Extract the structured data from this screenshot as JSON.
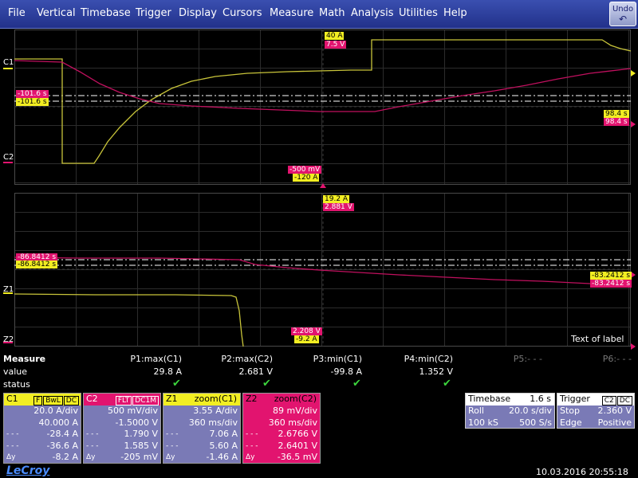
{
  "menu": [
    "File",
    "Vertical",
    "Timebase",
    "Trigger",
    "Display",
    "Cursors",
    "Measure",
    "Math",
    "Analysis",
    "Utilities",
    "Help"
  ],
  "undo_label": "Undo",
  "upper_plot": {
    "c1_label": "C1",
    "c2_label": "C2",
    "tag_top_a": "40 A",
    "tag_top_v": "7.5 V",
    "tag_left_1": "-101.6 s",
    "tag_left_2": "-101.6 s",
    "tag_right_1": "98.4 s",
    "tag_right_2": "98.4 s",
    "tag_bottom_v": "-500 mV",
    "tag_bottom_a": "-120 A"
  },
  "lower_plot": {
    "z1_label": "Z1",
    "z2_label": "Z2",
    "tag_top_a": "19.2 A",
    "tag_top_v": "2.881 V",
    "tag_left_1": "-86.8412 s",
    "tag_left_2": "-86.8412 s",
    "tag_right_1": "-83.2412 s",
    "tag_right_2": "-83.2412 s",
    "tag_bottom_v": "2.208 V",
    "tag_bottom_a": "-9.2 A",
    "text_of_label": "Text of label"
  },
  "measure": {
    "title": "Measure",
    "row_value": "value",
    "row_status": "status",
    "params": [
      {
        "name": "P1:max(C1)",
        "value": "29.8 A",
        "ok": true
      },
      {
        "name": "P2:max(C2)",
        "value": "2.681 V",
        "ok": true
      },
      {
        "name": "P3:min(C1)",
        "value": "-99.8 A",
        "ok": true
      },
      {
        "name": "P4:min(C2)",
        "value": "1.352 V",
        "ok": true
      },
      {
        "name": "P5:- - -",
        "value": "",
        "ok": false
      },
      {
        "name": "P6:- - -",
        "value": "",
        "ok": false
      }
    ]
  },
  "descriptors": {
    "c1": {
      "name": "C1",
      "badges": [
        "F",
        "BwL",
        "DC"
      ],
      "rows": [
        "20.0 A/div",
        "40.000 A",
        "-28.4 A",
        "-36.6 A",
        "-8.2 A"
      ],
      "row_labels": [
        "",
        "",
        "- - -",
        "- - -",
        "Δy"
      ]
    },
    "c2": {
      "name": "C2",
      "badges": [
        "FLT",
        "DC1M"
      ],
      "rows": [
        "500 mV/div",
        "-1.5000 V",
        "1.790 V",
        "1.585 V",
        "-205 mV"
      ],
      "row_labels": [
        "",
        "",
        "- - -",
        "- - -",
        "Δy"
      ]
    },
    "z1": {
      "name": "Z1",
      "title": "zoom(C1)",
      "rows": [
        "3.55 A/div",
        "360 ms/div",
        "7.06 A",
        "5.60 A",
        "-1.46 A"
      ],
      "row_labels": [
        "",
        "",
        "- - -",
        "- - -",
        "Δy"
      ]
    },
    "z2": {
      "name": "Z2",
      "title": "zoom(C2)",
      "rows": [
        "89 mV/div",
        "360 ms/div",
        "2.6766 V",
        "2.6401 V",
        "-36.5 mV"
      ],
      "row_labels": [
        "",
        "",
        "- - -",
        "- - -",
        "Δy"
      ]
    }
  },
  "timebase": {
    "title": "Timebase",
    "delay": "1.6 s",
    "mode": "Roll",
    "div": "20.0 s/div",
    "samples": "100 kS",
    "rate": "500 S/s"
  },
  "trigger": {
    "title": "Trigger",
    "badges": [
      "C2",
      "DC"
    ],
    "mode": "Stop",
    "level": "2.360 V",
    "type": "Edge",
    "slope": "Positive"
  },
  "brand": "LeCroy",
  "datetime": "10.03.2016 20:55:18",
  "colors": {
    "c1": "#f2ee22",
    "c2": "#e2146f",
    "menu": "#2a3a9a"
  }
}
